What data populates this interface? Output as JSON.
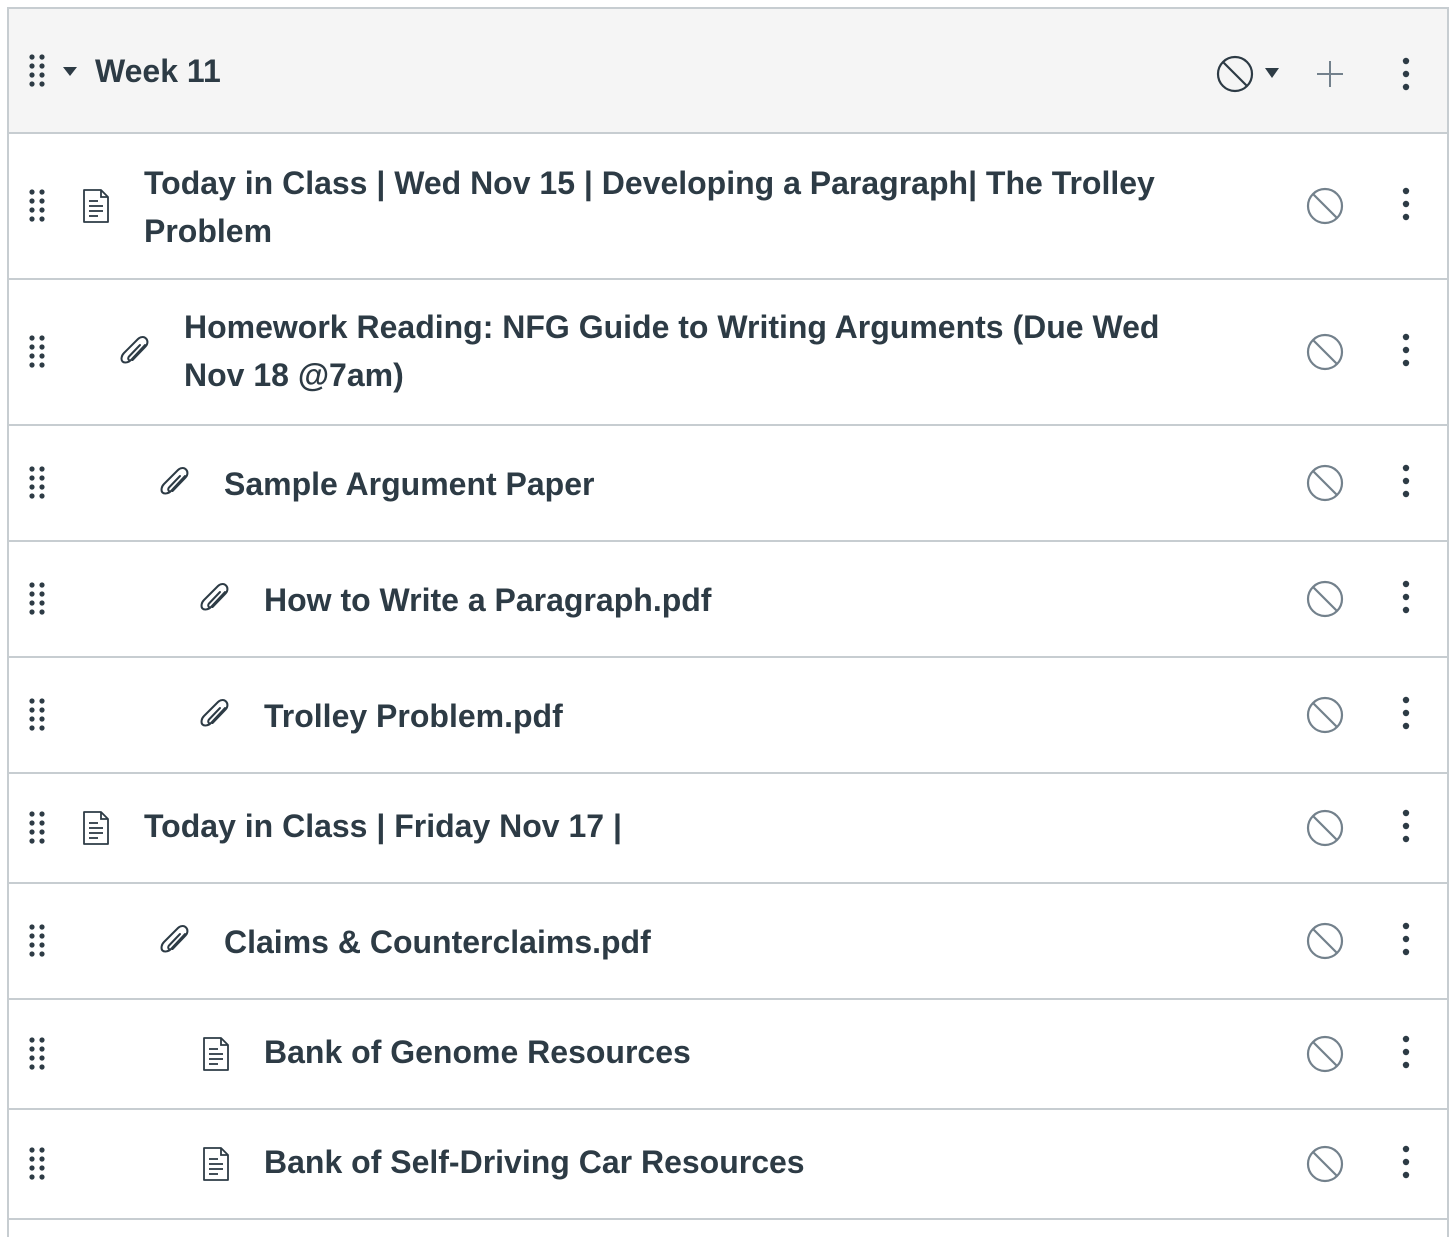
{
  "module": {
    "title": "Week 11",
    "header_icons": [
      "drag-handle-icon",
      "caret-down-icon",
      "unpublished-icon",
      "caret-down-icon",
      "plus-icon",
      "kebab-menu-icon"
    ]
  },
  "colors": {
    "text": "#2d3b45",
    "border": "#c7cdd1",
    "header_bg": "#f5f5f5",
    "icon_gray": "#73818c"
  },
  "items": [
    {
      "title": "Today in Class | Wed Nov 15 | Developing a Paragraph| The Trolley Problem",
      "icon": "page-icon",
      "indent": 0
    },
    {
      "title": "Homework Reading: NFG Guide to Writing Arguments (Due Wed Nov 18 @7am)",
      "icon": "attachment-icon",
      "indent": 1
    },
    {
      "title": "Sample Argument Paper",
      "icon": "attachment-icon",
      "indent": 2
    },
    {
      "title": "How to Write a Paragraph.pdf",
      "icon": "attachment-icon",
      "indent": 3
    },
    {
      "title": "Trolley Problem.pdf",
      "icon": "attachment-icon",
      "indent": 3
    },
    {
      "title": "Today in Class | Friday Nov 17 |",
      "icon": "page-icon",
      "indent": 0
    },
    {
      "title": "Claims & Counterclaims.pdf",
      "icon": "attachment-icon",
      "indent": 2
    },
    {
      "title": "Bank of Genome Resources",
      "icon": "page-icon",
      "indent": 3
    },
    {
      "title": "Bank of Self-Driving Car Resources",
      "icon": "page-icon",
      "indent": 3
    }
  ]
}
